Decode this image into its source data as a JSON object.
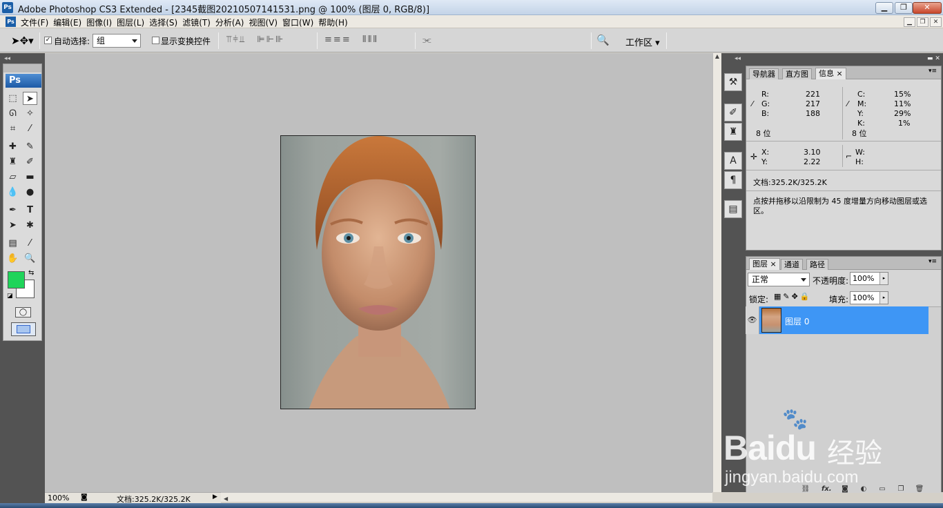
{
  "window": {
    "title": "Adobe Photoshop CS3 Extended - [2345截图20210507141531.png @ 100% (图层 0, RGB/8)]",
    "app_icon": "Ps"
  },
  "menu": {
    "items": [
      "文件(F)",
      "编辑(E)",
      "图像(I)",
      "图层(L)",
      "选择(S)",
      "滤镜(T)",
      "分析(A)",
      "视图(V)",
      "窗口(W)",
      "帮助(H)"
    ]
  },
  "options": {
    "auto_select_label": "自动选择:",
    "auto_select_value": "组",
    "auto_select_checked": "✓",
    "show_transform_label": "显示变换控件",
    "workspace_label": "工作区"
  },
  "toolbox": {
    "logo": "Ps",
    "foreground_color": "#1fd45a",
    "background_color": "#ffffff"
  },
  "status": {
    "zoom": "100%",
    "doc": "文档:325.2K/325.2K"
  },
  "info_panel": {
    "tabs": [
      "导航器",
      "直方图",
      "信息"
    ],
    "active_tab": "信息",
    "rgb": [
      {
        "k": "R:",
        "v": "221"
      },
      {
        "k": "G:",
        "v": "217"
      },
      {
        "k": "B:",
        "v": "188"
      }
    ],
    "cmyk": [
      {
        "k": "C:",
        "v": "15%"
      },
      {
        "k": "M:",
        "v": "11%"
      },
      {
        "k": "Y:",
        "v": "29%"
      },
      {
        "k": "K:",
        "v": "1%"
      }
    ],
    "bit_left": "8 位",
    "bit_right": "8 位",
    "xy": [
      {
        "k": "X:",
        "v": "3.10"
      },
      {
        "k": "Y:",
        "v": "2.22"
      }
    ],
    "wh": [
      {
        "k": "W:",
        "v": ""
      },
      {
        "k": "H:",
        "v": ""
      }
    ],
    "doc": "文档:325.2K/325.2K",
    "hint": "点按并拖移以沿限制为 45 度增量方向移动图层或选区。"
  },
  "layers_panel": {
    "tabs": [
      "图层",
      "通道",
      "路径"
    ],
    "blend_mode": "正常",
    "opacity_label": "不透明度:",
    "opacity": "100%",
    "lock_label": "锁定:",
    "fill_label": "填充:",
    "fill": "100%",
    "layer_name": "图层 0"
  },
  "watermark": {
    "brand": "Bai",
    "brand2": "du",
    "cn": "经验",
    "url": "jingyan.baidu.com"
  }
}
